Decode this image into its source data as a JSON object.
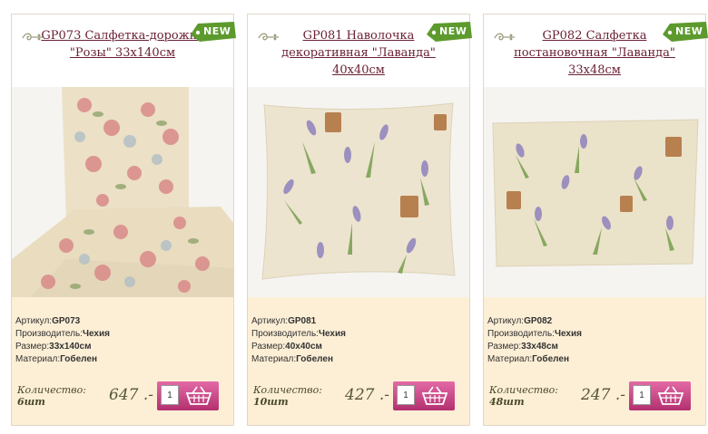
{
  "products": [
    {
      "title": "GP073 Салфетка-дорожка \"Розы\" 33х140см",
      "badge": "NEW",
      "specs": {
        "article_label": "Артикул:",
        "article": "GP073",
        "maker_label": "Производитель:",
        "maker": "Чехия",
        "size_label": "Размер:",
        "size": "33х140см",
        "material_label": "Материал:",
        "material": "Гобелен"
      },
      "qty_label": "Количество:",
      "qty": "6шт",
      "price": "647 .-",
      "input_value": "1",
      "image_desc": "rose-runner"
    },
    {
      "title": "GP081 Наволочка декоративная \"Лаванда\" 40х40см",
      "badge": "NEW",
      "specs": {
        "article_label": "Артикул:",
        "article": "GP081",
        "maker_label": "Производитель:",
        "maker": "Чехия",
        "size_label": "Размер:",
        "size": "40х40см",
        "material_label": "Материал:",
        "material": "Гобелен"
      },
      "qty_label": "Количество:",
      "qty": "10шт",
      "price": "427 .-",
      "input_value": "1",
      "image_desc": "lavender-pillow"
    },
    {
      "title": "GP082 Салфетка постановочная \"Лаванда\" 33х48см",
      "badge": "NEW",
      "specs": {
        "article_label": "Артикул:",
        "article": "GP082",
        "maker_label": "Производитель:",
        "maker": "Чехия",
        "size_label": "Размер:",
        "size": "33х48см",
        "material_label": "Материал:",
        "material": "Гобелен"
      },
      "qty_label": "Количество:",
      "qty": "48шт",
      "price": "247 .-",
      "input_value": "1",
      "image_desc": "lavender-placemat"
    }
  ],
  "colors": {
    "title": "#6a2134",
    "info_bg": "#fdefd6",
    "badge": "#5d9a2e",
    "cart_button": "#c8407f"
  },
  "icons": {
    "swirl": "swirl-ornament-icon",
    "cart": "shopping-basket-icon"
  }
}
